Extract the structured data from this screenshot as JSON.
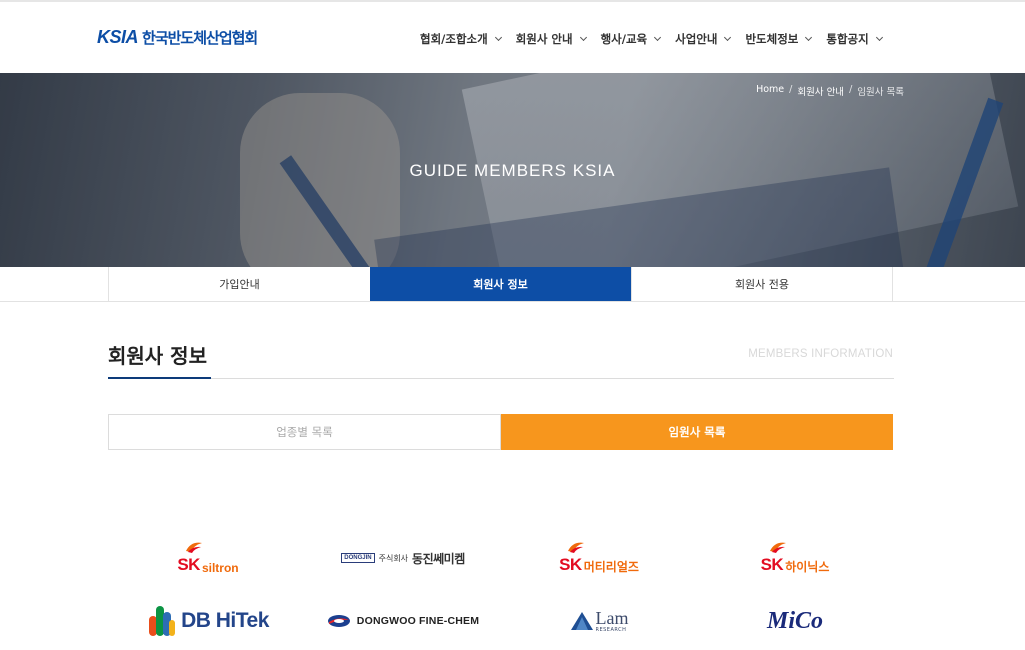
{
  "header": {
    "logo_en": "KSIA",
    "logo_ko": "한국반도체산업협회",
    "nav": [
      {
        "label": "협회/조합소개"
      },
      {
        "label": "회원사 안내"
      },
      {
        "label": "행사/교육"
      },
      {
        "label": "사업안내"
      },
      {
        "label": "반도체정보"
      },
      {
        "label": "통합공지"
      }
    ]
  },
  "hero": {
    "title": "GUIDE MEMBERS KSIA",
    "breadcrumb": [
      "Home",
      "회원사 안내",
      "임원사 목록"
    ]
  },
  "tabs": [
    {
      "label": "가입안내",
      "active": false
    },
    {
      "label": "회원사 정보",
      "active": true
    },
    {
      "label": "회원사 전용",
      "active": false
    }
  ],
  "section": {
    "title": "회원사 정보",
    "subtitle": "MEMBERS INFORMATION"
  },
  "subtabs": [
    {
      "label": "업종별 목록",
      "active": false
    },
    {
      "label": "임원사 목록",
      "active": true
    }
  ],
  "members": [
    {
      "name": "SK siltron",
      "brand": "SK",
      "sub": "siltron"
    },
    {
      "name": "주식회사 동진쎄미켐",
      "box": "DONGJIN",
      "small": "주식회사",
      "big": "동진쎄미켐"
    },
    {
      "name": "SK 머티리얼즈",
      "brand": "SK",
      "sub": "머티리얼즈"
    },
    {
      "name": "SK 하이닉스",
      "brand": "SK",
      "sub": "하이닉스"
    },
    {
      "name": "DB HiTek",
      "text": "DB HiTek"
    },
    {
      "name": "DONGWOO FINE-CHEM",
      "text": "DONGWOO FINE-CHEM"
    },
    {
      "name": "Lam RESEARCH",
      "text": "Lam",
      "sub": "RESEARCH"
    },
    {
      "name": "MiCo",
      "text": "MiCo"
    }
  ],
  "colors": {
    "brand_blue": "#0d4ea6",
    "accent_orange": "#f7961d",
    "sk_red": "#e30c21",
    "sk_orange": "#f06a0c"
  }
}
